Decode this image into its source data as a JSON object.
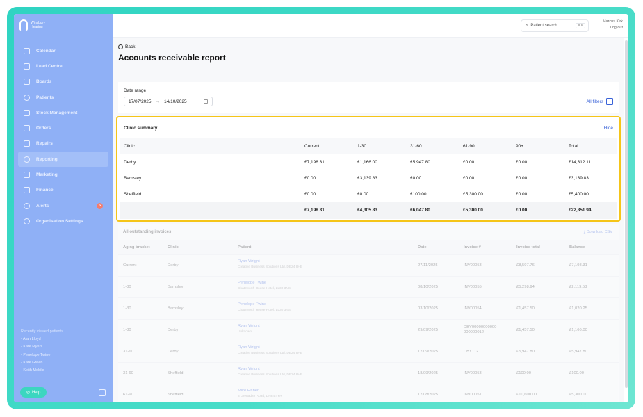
{
  "brand": {
    "line1": "Winsbury",
    "line2": "Hearing"
  },
  "nav": [
    {
      "label": "Calendar",
      "icon": "calendar-icon"
    },
    {
      "label": "Lead Centre",
      "icon": "headset-icon"
    },
    {
      "label": "Boards",
      "icon": "board-icon"
    },
    {
      "label": "Patients",
      "icon": "patients-icon"
    },
    {
      "label": "Stock Management",
      "icon": "box-icon"
    },
    {
      "label": "Orders",
      "icon": "orders-icon"
    },
    {
      "label": "Repairs",
      "icon": "wrench-icon"
    },
    {
      "label": "Reporting",
      "icon": "chart-icon",
      "active": true
    },
    {
      "label": "Marketing",
      "icon": "marketing-icon"
    },
    {
      "label": "Finance",
      "icon": "finance-icon"
    },
    {
      "label": "Alerts",
      "icon": "bell-icon",
      "badge": "6"
    },
    {
      "label": "Organisation Settings",
      "icon": "gear-icon"
    }
  ],
  "recent": {
    "title": "Recently viewed patients",
    "items": [
      "- Alan Lloyd",
      "- Kate Myers",
      "- Penelope Twine",
      "- Kate Green",
      "- Keith Mobile"
    ]
  },
  "help_label": "Help",
  "topbar": {
    "search_label": "Patient search",
    "search_shortcut": "⌘K",
    "user_name": "Marcus Kirk",
    "logout": "Log out"
  },
  "page": {
    "back": "Back",
    "title": "Accounts receivable report"
  },
  "filters": {
    "date_range_label": "Date range",
    "date_from": "17/07/2025",
    "date_to": "14/10/2025",
    "all_filters": "All filters"
  },
  "summary": {
    "title": "Clinic summary",
    "hide": "Hide",
    "headers": [
      "Clinic",
      "Current",
      "1-30",
      "31-60",
      "61-90",
      "90+",
      "Total"
    ],
    "rows": [
      [
        "Derby",
        "£7,198.31",
        "£1,166.00",
        "£5,947.80",
        "£0.00",
        "£0.00",
        "£14,312.11"
      ],
      [
        "Barnsley",
        "£0.00",
        "£3,139.83",
        "£0.00",
        "£0.00",
        "£0.00",
        "£3,139.83"
      ],
      [
        "Sheffield",
        "£0.00",
        "£0.00",
        "£100.00",
        "£5,300.00",
        "£0.00",
        "£5,400.00"
      ]
    ],
    "totals": [
      "",
      "£7,198.31",
      "£4,305.83",
      "£6,047.80",
      "£5,300.00",
      "£0.00",
      "£22,851.94"
    ]
  },
  "invoices": {
    "title": "All outstanding invoices",
    "download": "Download CSV",
    "headers": [
      "Aging bracket",
      "Clinic",
      "Patient",
      "Date",
      "Invoice #",
      "Invoice total",
      "Balance"
    ],
    "rows": [
      {
        "bracket": "Current",
        "clinic": "Derby",
        "patient": "Ryan Wright",
        "company": "Creative Business Solutions Ltd, DE24 8HB",
        "date": "27/11/2025",
        "invoice": "INV00053",
        "total": "£8,597.76",
        "balance": "£7,198.31"
      },
      {
        "bracket": "1-30",
        "clinic": "Barnsley",
        "patient": "Penelope Twine",
        "company": "Chatsworth House Hotel, LL30 3NS",
        "date": "08/10/2025",
        "invoice": "INV00055",
        "total": "£5,298.94",
        "balance": "£2,119.58"
      },
      {
        "bracket": "1-30",
        "clinic": "Barnsley",
        "patient": "Penelope Twine",
        "company": "Chatsworth House Hotel, LL30 3NS",
        "date": "03/10/2025",
        "invoice": "INV00054",
        "total": "£1,457.50",
        "balance": "£1,020.25"
      },
      {
        "bracket": "1-30",
        "clinic": "Derby",
        "patient": "Ryan Wright",
        "company": "Unknown",
        "date": "29/09/2025",
        "invoice": "DBY00000000000 000000012",
        "total": "£1,457.50",
        "balance": "£1,166.00"
      },
      {
        "bracket": "31-60",
        "clinic": "Derby",
        "patient": "Ryan Wright",
        "company": "Creative Business Solutions Ltd, DE24 8HB",
        "date": "12/09/2025",
        "invoice": "DBY112",
        "total": "£5,947.80",
        "balance": "£5,947.80"
      },
      {
        "bracket": "31-60",
        "clinic": "Sheffield",
        "patient": "Ryan Wright",
        "company": "Creative Business Solutions Ltd, DE24 8HB",
        "date": "18/09/2025",
        "invoice": "INV00053",
        "total": "£100.00",
        "balance": "£100.00"
      },
      {
        "bracket": "61-90",
        "clinic": "Sheffield",
        "patient": "Mike Fisher",
        "company": "3 Grenadier Road, DH84 4YR",
        "date": "12/08/2025",
        "invoice": "INV00051",
        "total": "£10,600.00",
        "balance": "£5,300.00"
      }
    ]
  },
  "colors": {
    "sidebar": "#8fb0f6",
    "accent": "#3a63d8",
    "highlight": "#f5c519",
    "frame": "#2fd4c2"
  }
}
